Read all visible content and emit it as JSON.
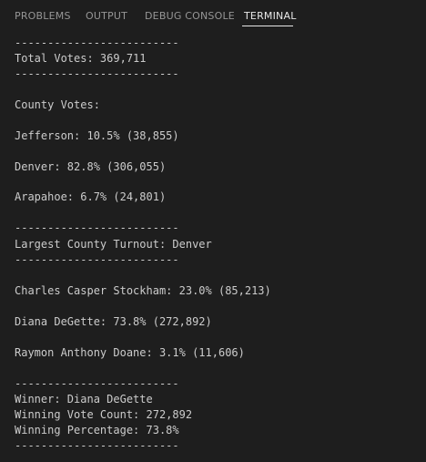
{
  "tabs": [
    {
      "label": "PROBLEMS",
      "active": false
    },
    {
      "label": "OUTPUT",
      "active": false
    },
    {
      "label": "DEBUG CONSOLE",
      "active": false
    },
    {
      "label": "TERMINAL",
      "active": true
    }
  ],
  "terminal": {
    "lines": [
      "-------------------------",
      "Total Votes: 369,711",
      "-------------------------",
      "County Votes:",
      "Jefferson: 10.5% (38,855)",
      "Denver: 82.8% (306,055)",
      "Arapahoe: 6.7% (24,801)",
      "-------------------------",
      "Largest County Turnout: Denver",
      "-------------------------",
      "Charles Casper Stockham: 23.0% (85,213)",
      "Diana DeGette: 73.8% (272,892)",
      "Raymon Anthony Doane: 3.1% (11,606)",
      "-------------------------",
      "Winner: Diana DeGette",
      "Winning Vote Count: 272,892",
      "Winning Percentage: 73.8%",
      "-------------------------"
    ]
  },
  "colors": {
    "background": "#1e1e1e",
    "text": "#cccccc",
    "tab_inactive": "#969696",
    "tab_active": "#e7e7e7"
  }
}
